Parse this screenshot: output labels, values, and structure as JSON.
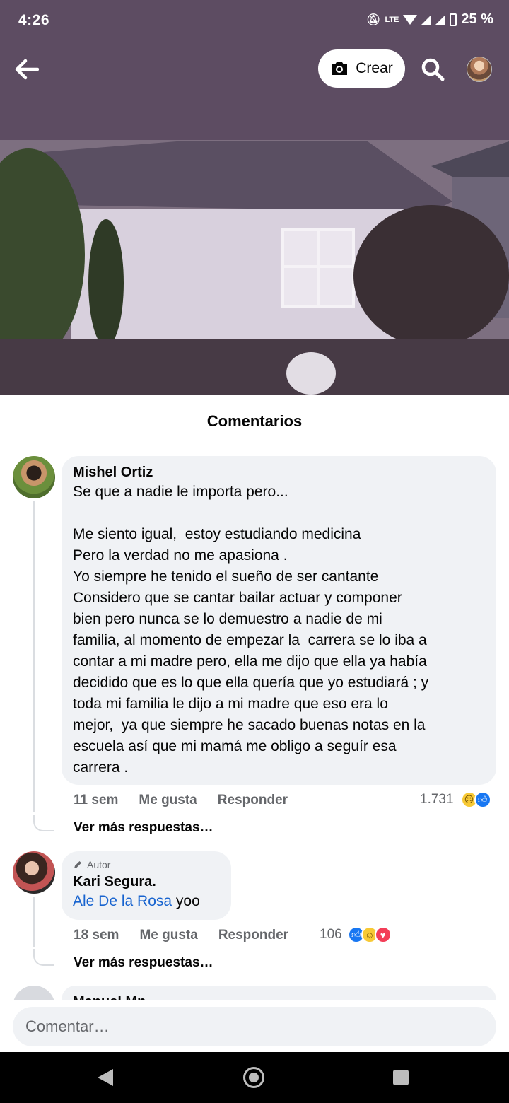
{
  "status_bar": {
    "time": "4:26",
    "battery": "25 %",
    "network_label": "LTE"
  },
  "header": {
    "create_label": "Crear"
  },
  "comments": {
    "title": "Comentarios",
    "items": [
      {
        "author": "Mishel Ortiz",
        "text": "Se que a nadie le importa pero...\n\nMe siento igual,  estoy estudiando medicina\nPero la verdad no me apasiona .\nYo siempre he tenido el sueño de ser cantante\nConsidero que se cantar bailar actuar y componer\nbien pero nunca se lo demuestro a nadie de mi\nfamilia, al momento de empezar la  carrera se lo iba a\ncontar a mi madre pero, ella me dijo que ella ya había\ndecidido que es lo que ella quería que yo estudiará ; y\ntoda mi familia le dijo a mi madre que eso era lo\nmejor,  ya que siempre he sacado buenas notas en la\nescuela así que mi mamá me obligo a seguír esa\ncarrera .",
        "time": "11 sem",
        "like_label": "Me gusta",
        "reply_label": "Responder",
        "reaction_count": "1.731",
        "reactions": [
          "sad",
          "like"
        ],
        "more_replies": "Ver más respuestas…"
      },
      {
        "badge": "Autor",
        "author": "Kari Segura.",
        "mention": "Ale De la Rosa",
        "text": " yoo",
        "time": "18 sem",
        "like_label": "Me gusta",
        "reply_label": "Responder",
        "reaction_count": "106",
        "reactions": [
          "like",
          "haha",
          "love"
        ],
        "more_replies": "Ver más respuestas…"
      },
      {
        "author": "Manuel Mn"
      }
    ]
  },
  "composer": {
    "placeholder": "Comentar…"
  }
}
